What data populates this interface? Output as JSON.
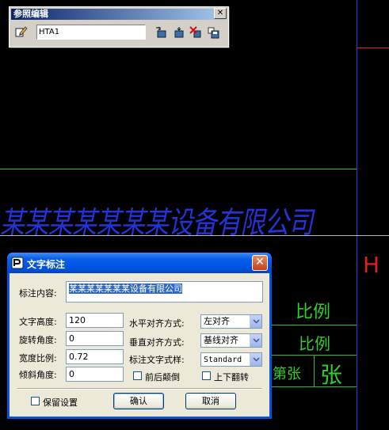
{
  "toolbar": {
    "title": "参照编辑",
    "close_label": "✕",
    "name_value": "HTA1"
  },
  "canvas": {
    "company_text": "某某某某某某某设备有限公司",
    "ratio_label_1": "比例",
    "ratio_label_2": "比例",
    "sheet_label": "第张",
    "zhang_label": "张",
    "h_label": "H"
  },
  "dialog": {
    "title": "文字标注",
    "content_label": "标注内容:",
    "content_value": "某某某某某某某设备有限公司",
    "height_label": "文字高度:",
    "height_value": "120",
    "rotate_label": "旋转角度:",
    "rotate_value": "0",
    "width_label": "宽度比例:",
    "width_value": "0.72",
    "slant_label": "倾斜角度:",
    "slant_value": "0",
    "h_align_label": "水平对齐方式:",
    "h_align_value": "左对齐",
    "v_align_label": "垂直对齐方式:",
    "v_align_value": "基线对齐",
    "style_label": "标注文字式样:",
    "style_value": "Standard",
    "reverse_label": "前后颠倒",
    "flip_label": "上下翻转",
    "keep_label": "保留设置",
    "ok_label": "确认",
    "cancel_label": "取消"
  },
  "colors": {
    "cad_background": "#000000",
    "green_line": "#2fbf2f",
    "blue_line": "#2b3bd8",
    "red_line": "#dd2222",
    "xp_title_blue": "#0054e3",
    "dialog_face": "#ece9d8"
  }
}
